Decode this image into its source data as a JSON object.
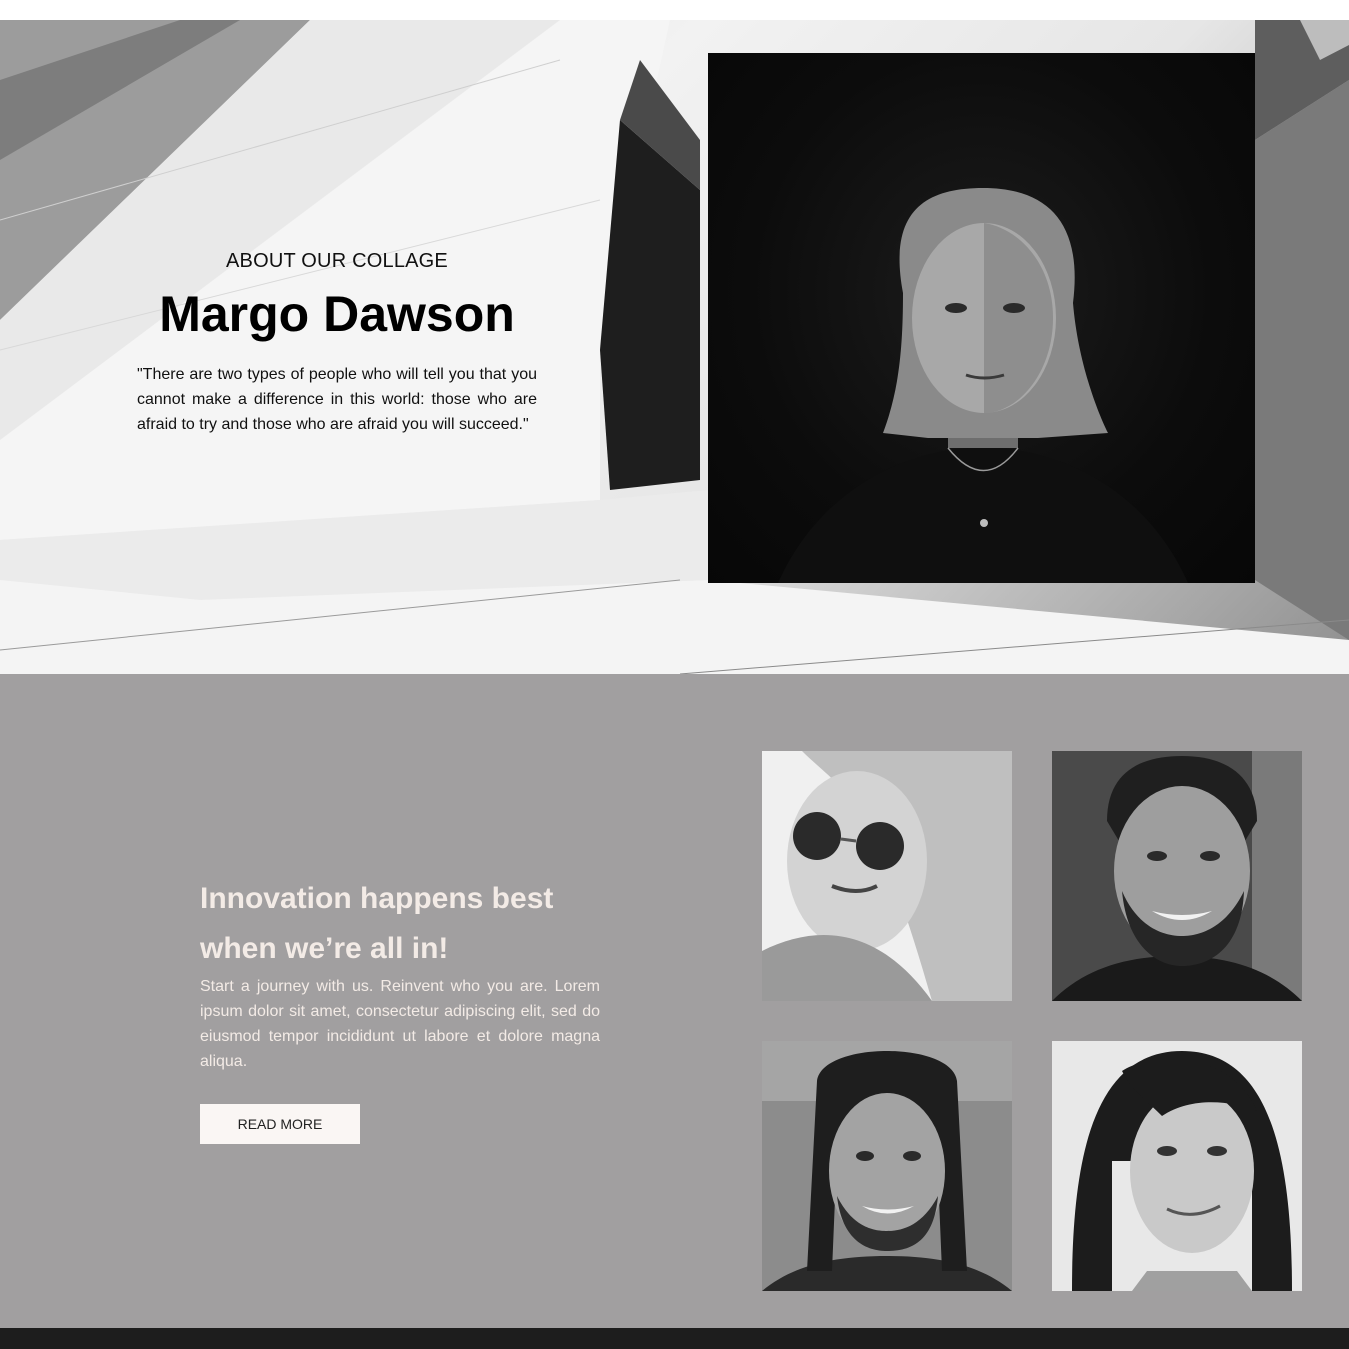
{
  "hero": {
    "eyebrow": "ABOUT OUR COLLAGE",
    "name": "Margo Dawson",
    "quote": "\"There are two types of people who will tell you that you cannot make a difference in this world: those who are afraid to try and those who are afraid you will succeed.\""
  },
  "innovation": {
    "title": "Innovation happens best when we’re all in!",
    "body": "Start a journey with us. Reinvent who you are. Lorem ipsum dolor sit amet, consectetur adipiscing elit, sed do eiusmod tempor incididunt ut labore et dolore magna aliqua.",
    "button_label": "READ MORE"
  },
  "colors": {
    "innovation_bg": "#a19fa0",
    "innovation_text": "#f3ebe6",
    "button_bg": "#faf6f4",
    "footer_bg": "#1d1d1d"
  },
  "icons": [
    "architecture-background-image",
    "woman-portrait-image",
    "team-photo-images"
  ]
}
